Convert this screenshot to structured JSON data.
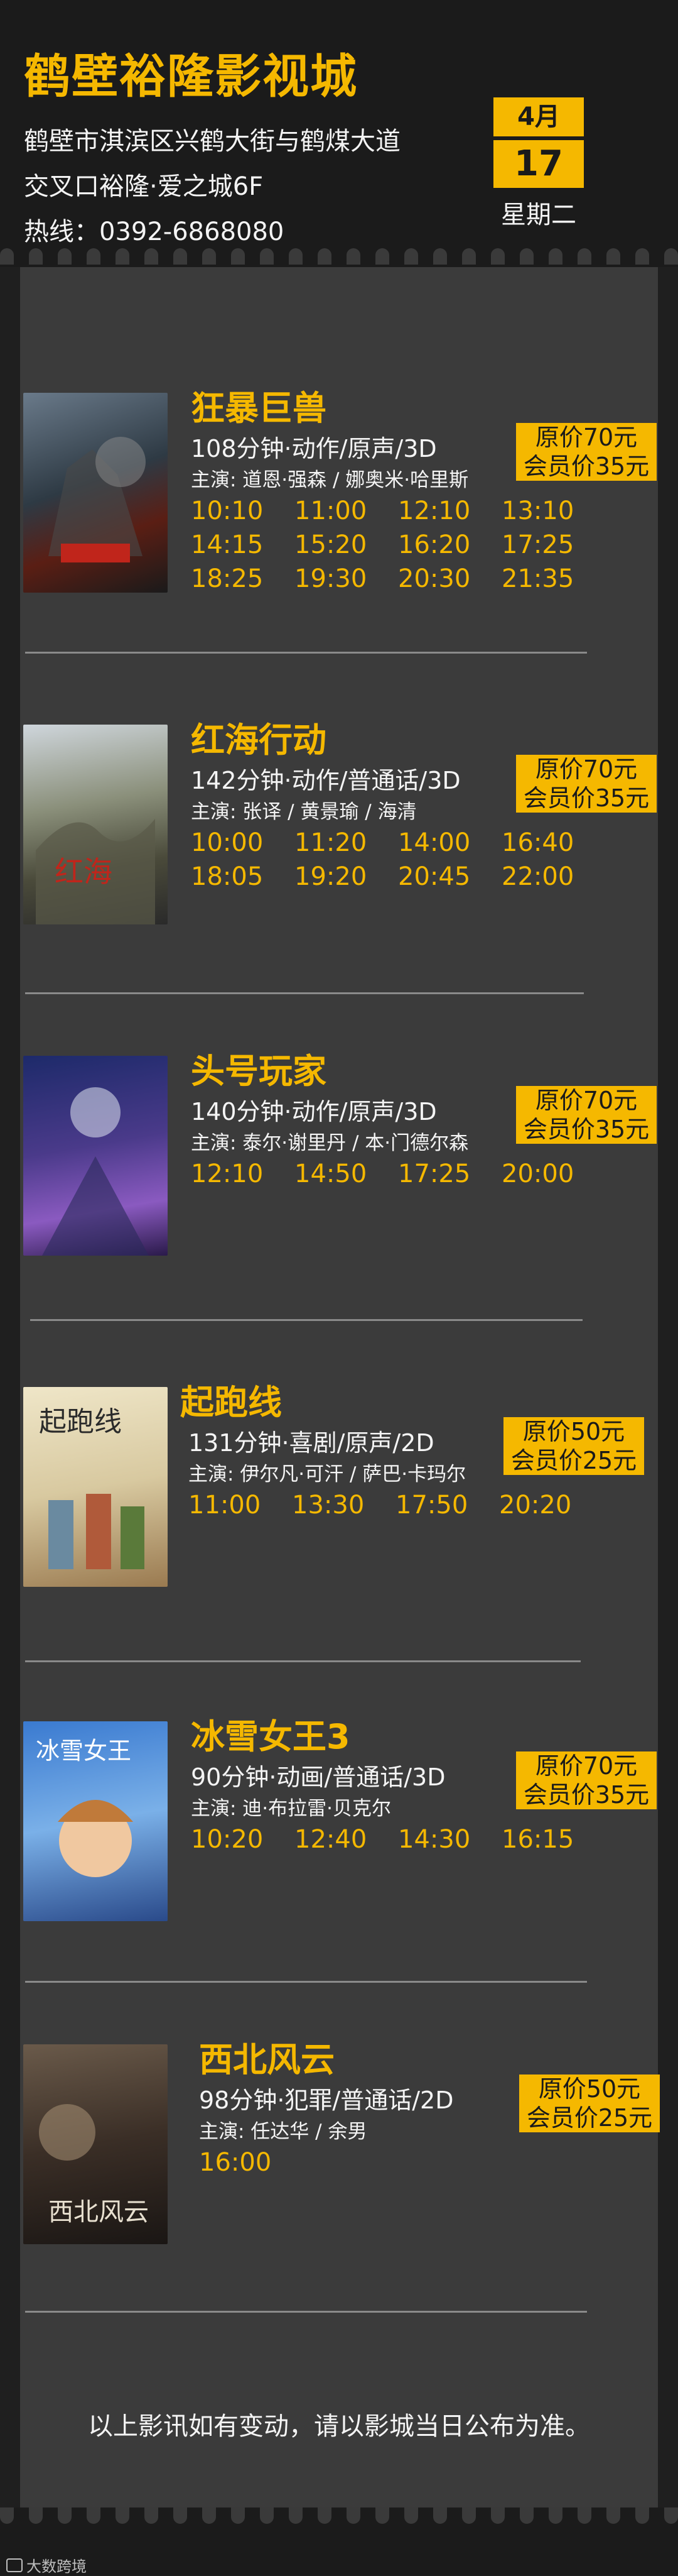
{
  "header": {
    "title": "鹤壁裕隆影视城",
    "address_line1": "鹤壁市淇滨区兴鹤大街与鹤煤大道",
    "address_line2": "交叉口裕隆·爱之城6F",
    "hotline": "热线：0392-6868080",
    "date": {
      "month": "4月",
      "day": "17",
      "weekday": "星期二"
    }
  },
  "colors": {
    "accent": "#f5b800",
    "panel": "#3b3b3b",
    "background": "#1f1f1f"
  },
  "movies": [
    {
      "name": "狂暴巨兽",
      "info": "108分钟·动作/原声/3D",
      "cast": "主演: 道恩·强森 / 娜奥米·哈里斯",
      "price_original": "原价70元",
      "price_member": "会员价35元",
      "times": [
        "10:10",
        "11:00",
        "12:10",
        "13:10",
        "14:15",
        "15:20",
        "16:20",
        "17:25",
        "18:25",
        "19:30",
        "20:30",
        "21:35"
      ]
    },
    {
      "name": "红海行动",
      "info": "142分钟·动作/普通话/3D",
      "cast": "主演: 张译 / 黄景瑜 / 海清",
      "price_original": "原价70元",
      "price_member": "会员价35元",
      "times": [
        "10:00",
        "11:20",
        "14:00",
        "16:40",
        "18:05",
        "19:20",
        "20:45",
        "22:00"
      ]
    },
    {
      "name": "头号玩家",
      "info": "140分钟·动作/原声/3D",
      "cast": "主演: 泰尔·谢里丹 / 本·门德尔森",
      "price_original": "原价70元",
      "price_member": "会员价35元",
      "times": [
        "12:10",
        "14:50",
        "17:25",
        "20:00"
      ]
    },
    {
      "name": "起跑线",
      "info": "131分钟·喜剧/原声/2D",
      "cast": "主演: 伊尔凡·可汗 / 萨巴·卡玛尔",
      "price_original": "原价50元",
      "price_member": "会员价25元",
      "times": [
        "11:00",
        "13:30",
        "17:50",
        "20:20"
      ]
    },
    {
      "name": "冰雪女王3",
      "info": "90分钟·动画/普通话/3D",
      "cast": "主演: 迪·布拉雷·贝克尔",
      "price_original": "原价70元",
      "price_member": "会员价35元",
      "times": [
        "10:20",
        "12:40",
        "14:30",
        "16:15"
      ]
    },
    {
      "name": "西北风云",
      "info": "98分钟·犯罪/普通话/2D",
      "cast": "主演: 任达华 / 余男",
      "price_original": "原价50元",
      "price_member": "会员价25元",
      "times": [
        "16:00"
      ]
    }
  ],
  "notice": "以上影讯如有变动，请以影城当日公布为准。",
  "footer": {
    "logo_text": "大数跨境"
  }
}
